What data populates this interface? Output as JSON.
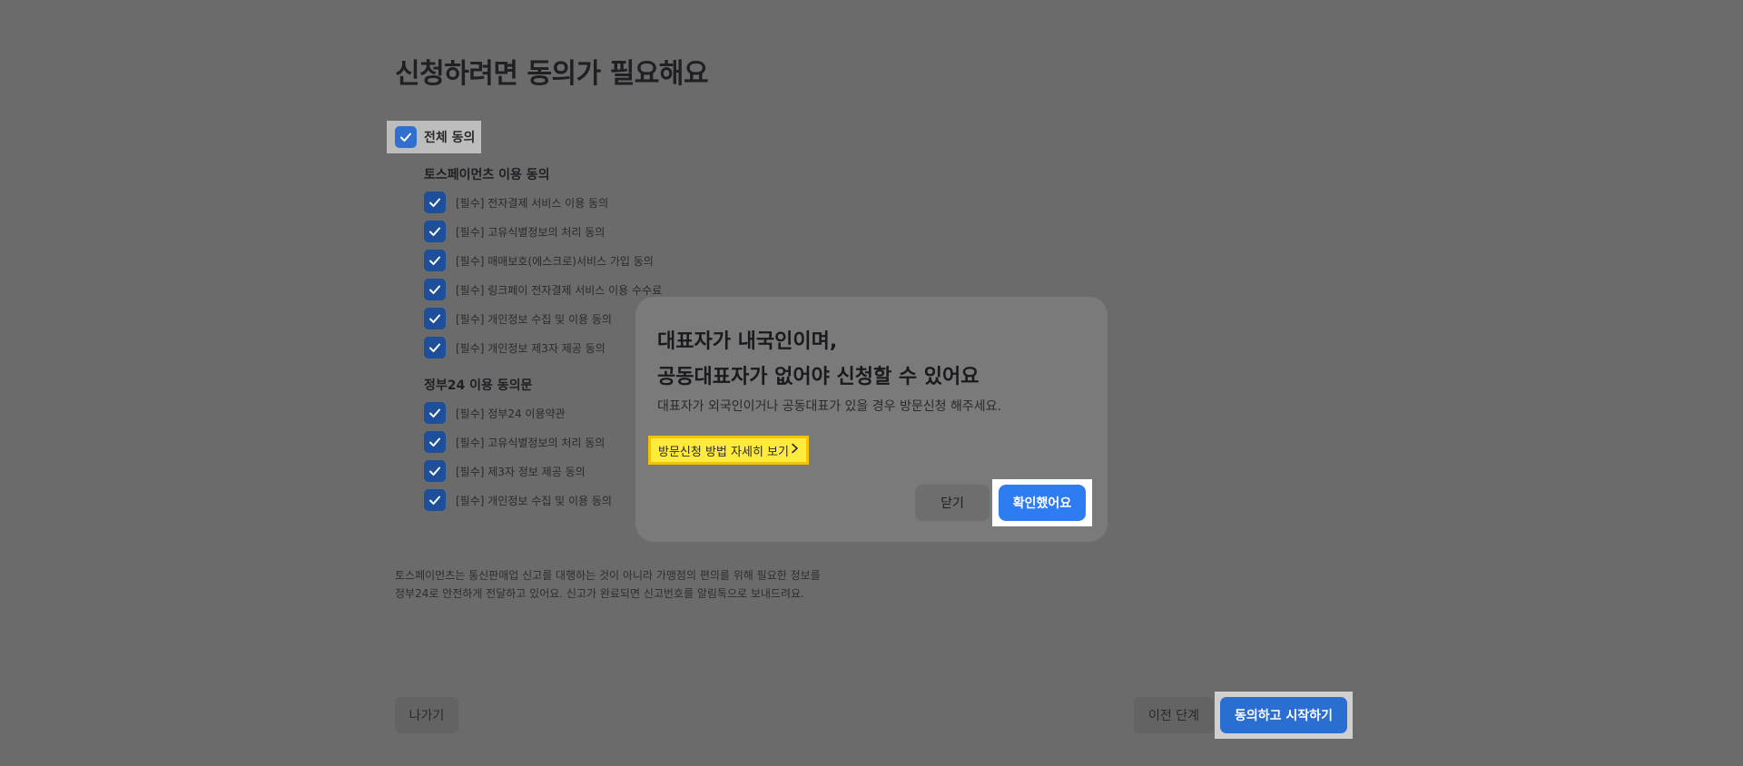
{
  "page": {
    "title": "신청하려면 동의가 필요해요",
    "all_agree_label": "전체 동의",
    "groups": [
      {
        "title": "토스페이먼츠 이용 동의",
        "items": [
          "[필수] 전자결제 서비스 이용 동의",
          "[필수] 고유식별정보의 처리 동의",
          "[필수] 매매보호(에스크로)서비스 가입 동의",
          "[필수] 링크페이 전자결제 서비스 이용 수수료",
          "[필수] 개인정보 수집 및 이용 동의",
          "[필수] 개인정보 제3자 제공 동의"
        ]
      },
      {
        "title": "정부24 이용 동의문",
        "items": [
          "[필수] 정부24 이용약관",
          "[필수] 고유식별정보의 처리 동의",
          "[필수] 제3자 정보 제공 동의",
          "[필수] 개인정보 수집 및 이용 동의"
        ]
      }
    ],
    "notice_lines": [
      "토스페이먼츠는 통신판매업 신고를 대행하는 것이 아니라 가맹점의 편의를 위해 필요한 정보를",
      "정부24로 안전하게 전달하고 있어요. 신고가 완료되면 신고번호를 알림톡으로 보내드려요."
    ],
    "exit_label": "나가기",
    "prev_label": "이전 단계",
    "start_label": "동의하고 시작하기"
  },
  "modal": {
    "title_line1": "대표자가 내국인이며,",
    "title_line2": "공동대표자가 없어야 신청할 수 있어요",
    "description": "대표자가 외국인이거나 공동대표가 있을 경우 방문신청 해주세요.",
    "link_label": "방문신청 방법 자세히 보기",
    "close_label": "닫기",
    "confirm_label": "확인했어요"
  },
  "colors": {
    "accent": "#2e7cf2",
    "checkbox": "#1d4f9a",
    "link_highlight": "#ffeb3b",
    "overlay": "#6b6b6b"
  },
  "icons": {
    "checkbox": "check-icon",
    "link_chevron": "chevron-right-icon"
  }
}
